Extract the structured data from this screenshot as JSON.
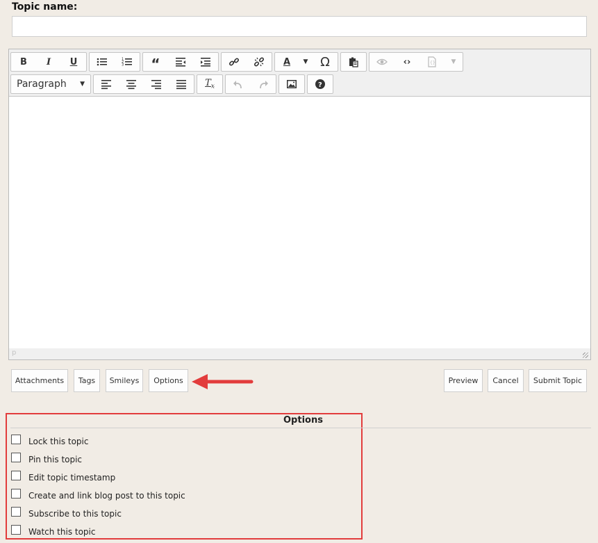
{
  "form": {
    "topic_label": "Topic name:",
    "topic_value": ""
  },
  "toolbar": {
    "row1": [
      "bold-icon",
      "italic-icon",
      "underline-icon",
      "bullet-list-icon",
      "numbered-list-icon",
      "blockquote-icon",
      "outdent-icon",
      "indent-icon",
      "link-icon",
      "unlink-icon",
      "text-color-icon",
      "special-character-icon",
      "paste-icon",
      "preview-icon",
      "source-code-icon",
      "template-icon"
    ],
    "text_color_label": "A",
    "omega": "Ω",
    "format_value": "Paragraph"
  },
  "editor": {
    "path": "p"
  },
  "buttons": {
    "attachments": "Attachments",
    "tags": "Tags",
    "smileys": "Smileys",
    "options": "Options",
    "preview": "Preview",
    "cancel": "Cancel",
    "submit": "Submit Topic"
  },
  "options_panel": {
    "title": "Options",
    "items": [
      {
        "label": "Lock this topic",
        "checked": false
      },
      {
        "label": "Pin this topic",
        "checked": false
      },
      {
        "label": "Edit topic timestamp",
        "checked": false
      },
      {
        "label": "Create and link blog post to this topic",
        "checked": false
      },
      {
        "label": "Subscribe to this topic",
        "checked": false
      },
      {
        "label": "Watch this topic",
        "checked": false
      }
    ]
  },
  "colors": {
    "background": "#f1ece5",
    "annotation_red": "#e23c3c"
  }
}
